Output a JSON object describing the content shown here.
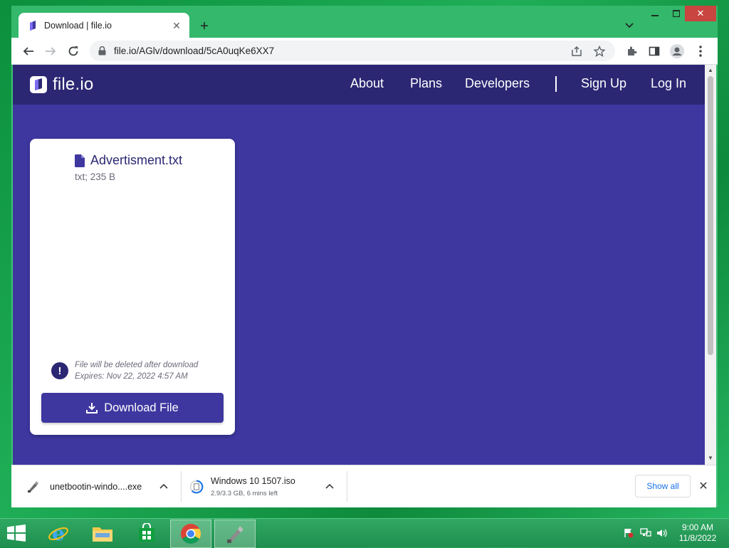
{
  "browser": {
    "tab": {
      "title": "Download | file.io"
    },
    "address": {
      "url": "file.io/AGlv/download/5cA0uqKe6XX7"
    }
  },
  "site": {
    "logo_text": "file.io",
    "nav": [
      "About",
      "Plans",
      "Developers",
      "Sign Up",
      "Log In"
    ]
  },
  "file": {
    "name": "Advertisment.txt",
    "meta": "txt; 235 B",
    "notice_line1": "File will be deleted after download",
    "notice_line2": "Expires: Nov 22, 2022 4:57 AM",
    "download_label": "Download File"
  },
  "downloads": {
    "items": [
      {
        "name": "unetbootin-windo....exe"
      },
      {
        "name": "Windows 10 1507.iso",
        "status": "2.9/3.3 GB, 6 mins left"
      }
    ],
    "show_all": "Show all"
  },
  "taskbar": {
    "time": "9:00 AM",
    "date": "11/8/2022"
  },
  "colors": {
    "header": "#2c2773",
    "page_bg": "#3e37a0",
    "button": "#3e37a0",
    "link": "#1a73e8"
  }
}
